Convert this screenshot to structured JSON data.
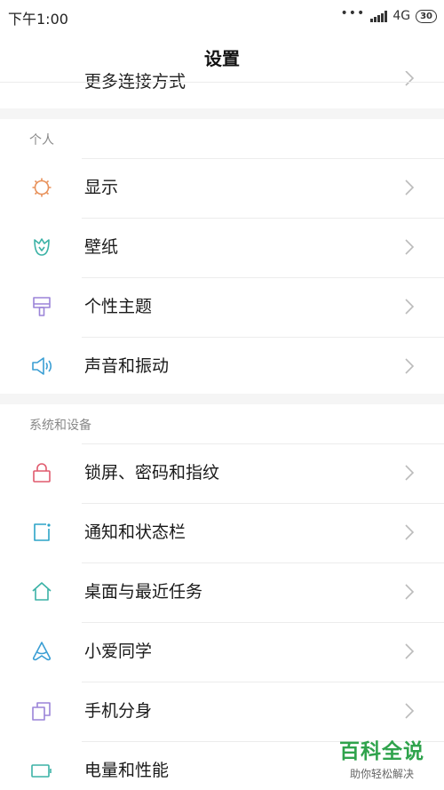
{
  "status_bar": {
    "time": "下午1:00",
    "dots": "•••",
    "network": "4G",
    "battery": "30"
  },
  "header": {
    "title": "设置"
  },
  "partial_item": {
    "label": "更多连接方式"
  },
  "sections": {
    "personal": {
      "label": "个人",
      "items": [
        {
          "label": "显示",
          "icon": "sun-icon"
        },
        {
          "label": "壁纸",
          "icon": "tulip-icon"
        },
        {
          "label": "个性主题",
          "icon": "paintbrush-icon"
        },
        {
          "label": "声音和振动",
          "icon": "speaker-icon"
        }
      ]
    },
    "system": {
      "label": "系统和设备",
      "items": [
        {
          "label": "锁屏、密码和指纹",
          "icon": "lock-icon"
        },
        {
          "label": "通知和状态栏",
          "icon": "notification-icon"
        },
        {
          "label": "桌面与最近任务",
          "icon": "home-icon"
        },
        {
          "label": "小爱同学",
          "icon": "assistant-icon"
        },
        {
          "label": "手机分身",
          "icon": "clone-icon"
        },
        {
          "label": "电量和性能",
          "icon": "battery-icon"
        }
      ]
    }
  },
  "colors": {
    "sun": "#e8915a",
    "tulip": "#3bb2a6",
    "paintbrush": "#9b84d8",
    "speaker": "#3a9ed4",
    "lock": "#e05a6d",
    "notification": "#2ba3c7",
    "home": "#3bb2a6",
    "assistant": "#3a9ed4",
    "clone": "#9b84d8",
    "battery": "#3bb2a6"
  },
  "watermark": {
    "title": "百科全说",
    "subtitle": "助你轻松解决"
  }
}
